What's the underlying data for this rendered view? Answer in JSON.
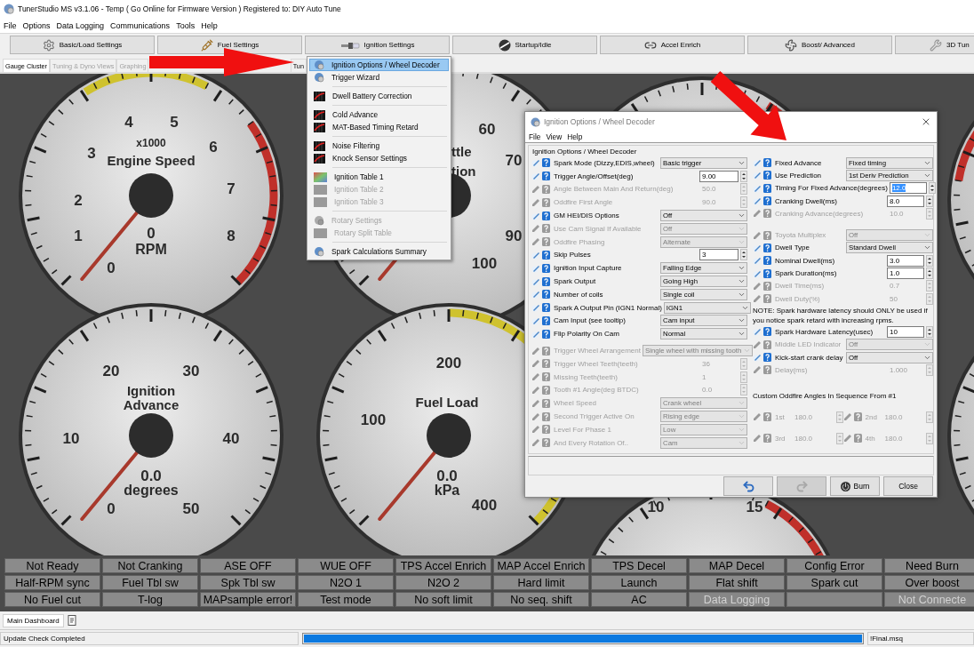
{
  "window": {
    "title": "TunerStudio MS v3.1.06 - Temp ( Go Online for Firmware Version ) Registered to: DIY Auto Tune"
  },
  "menu": [
    "File",
    "Options",
    "Data Logging",
    "Communications",
    "Tools",
    "Help"
  ],
  "toolbar": [
    {
      "label": "Basic/Load Settings",
      "kind": "gear"
    },
    {
      "label": "Fuel Settings",
      "kind": "injector"
    },
    {
      "label": "Ignition Settings",
      "kind": "plug"
    },
    {
      "label": "Startup/Idle",
      "kind": "knob"
    },
    {
      "label": "Accel Enrich",
      "kind": "link"
    },
    {
      "label": "Boost/ Advanced",
      "kind": "fan"
    },
    {
      "label": "3D Tun",
      "kind": "wrench"
    }
  ],
  "tabs": [
    {
      "label": "Gauge Cluster",
      "selected": true,
      "disabled": false
    },
    {
      "label": "Tuning & Dyno Views",
      "selected": false,
      "disabled": true
    },
    {
      "label": "Graphing",
      "selected": false,
      "disabled": true
    },
    {
      "label": "Tun",
      "selected": false,
      "disabled": false
    }
  ],
  "gauges": [
    {
      "title": [
        "Engine Speed"
      ],
      "scale": "x1000",
      "value": "0",
      "unit": "RPM",
      "ticks": [
        "0",
        "1",
        "2",
        "3",
        "4",
        "5",
        "6",
        "7",
        "8"
      ]
    },
    {
      "title": [
        "ttle",
        "tion"
      ],
      "ticks": [
        "60",
        "70",
        "90",
        "100"
      ]
    },
    {
      "title": [
        "Ignition",
        "Advance"
      ],
      "value": "0.0",
      "unit": "degrees",
      "ticks": [
        "0",
        "10",
        "20",
        "30",
        "40",
        "50"
      ]
    },
    {
      "title": [
        "Fuel Load"
      ],
      "value": "0.0",
      "unit": "kPa",
      "ticks": [
        "100",
        "200",
        "400"
      ]
    },
    {
      "ticks": [
        "10",
        "15"
      ]
    }
  ],
  "indicators": [
    {
      "label": "Not Ready",
      "disabled": false
    },
    {
      "label": "Not Cranking",
      "disabled": false
    },
    {
      "label": "ASE OFF",
      "disabled": false
    },
    {
      "label": "WUE OFF",
      "disabled": false
    },
    {
      "label": "TPS Accel Enrich",
      "disabled": false
    },
    {
      "label": "MAP Accel Enrich",
      "disabled": false
    },
    {
      "label": "TPS Decel",
      "disabled": false
    },
    {
      "label": "MAP Decel",
      "disabled": false
    },
    {
      "label": "Config Error",
      "disabled": false
    },
    {
      "label": "Need Burn",
      "disabled": false
    },
    {
      "label": "Half-RPM sync",
      "disabled": false
    },
    {
      "label": "Fuel Tbl sw",
      "disabled": false
    },
    {
      "label": "Spk Tbl sw",
      "disabled": false
    },
    {
      "label": "N2O 1",
      "disabled": false
    },
    {
      "label": "N2O 2",
      "disabled": false
    },
    {
      "label": "Hard limit",
      "disabled": false
    },
    {
      "label": "Launch",
      "disabled": false
    },
    {
      "label": "Flat shift",
      "disabled": false
    },
    {
      "label": "Spark cut",
      "disabled": false
    },
    {
      "label": "Over boost",
      "disabled": false
    },
    {
      "label": "No Fuel cut",
      "disabled": false
    },
    {
      "label": "T-log",
      "disabled": false
    },
    {
      "label": "MAPsample error!",
      "disabled": false
    },
    {
      "label": "Test mode",
      "disabled": false
    },
    {
      "label": "No soft limit",
      "disabled": false
    },
    {
      "label": "No seq. shift",
      "disabled": false
    },
    {
      "label": "AC",
      "disabled": false
    },
    {
      "label": "Data Logging",
      "disabled": true
    },
    {
      "disabled": true
    },
    {
      "label": "Not Connecte",
      "disabled": true
    }
  ],
  "dashboard_tabs": [
    {
      "label": "Main Dashboard",
      "selected": true
    }
  ],
  "status_bar": {
    "message": "Update Check Completed",
    "progress": {
      "level": 1
    },
    "file": "!Final.msq"
  },
  "dropdown": {
    "groups": [
      [
        {
          "label": "Ignition Options / Wheel Decoder",
          "kind": "wizard",
          "disabled": false,
          "selected": true
        },
        {
          "label": "Trigger Wizard",
          "kind": "wizard",
          "disabled": false,
          "selected": false
        }
      ],
      [
        {
          "label": "Dwell Battery Correction",
          "kind": "curve",
          "disabled": false,
          "selected": false
        }
      ],
      [
        {
          "label": "Cold Advance",
          "kind": "curve",
          "disabled": false,
          "selected": false
        },
        {
          "label": "MAT-Based Timing Retard",
          "kind": "curve",
          "disabled": false,
          "selected": false
        }
      ],
      [
        {
          "label": "Noise Filtering",
          "kind": "curve",
          "disabled": false,
          "selected": false
        },
        {
          "label": "Knock Sensor Settings",
          "kind": "curve",
          "disabled": false,
          "selected": false
        }
      ],
      [
        {
          "label": "Ignition Table 1",
          "kind": "table",
          "disabled": false,
          "selected": false
        },
        {
          "label": "Ignition Table 2",
          "kind": "table",
          "disabled": true,
          "selected": false
        },
        {
          "label": "Ignition Table 3",
          "kind": "table",
          "disabled": true,
          "selected": false
        }
      ],
      [
        {
          "label": "Rotary Settings",
          "kind": "wizard",
          "disabled": true,
          "selected": false
        },
        {
          "label": "Rotary Split Table",
          "kind": "table",
          "disabled": true,
          "selected": false
        }
      ],
      [
        {
          "label": "Spark Calculations Summary",
          "kind": "wizard",
          "disabled": false,
          "selected": false
        }
      ]
    ]
  },
  "dialog": {
    "title": "Ignition Options / Wheel Decoder",
    "menu": [
      "File",
      "View",
      "Help"
    ],
    "group": "Ignition Options / Wheel Decoder",
    "left": [
      {
        "kind": "select",
        "label": "Spark Mode (Dizzy,EDIS,wheel)",
        "value": "Basic trigger",
        "disabled": false
      },
      {
        "kind": "number",
        "label": "Trigger Angle/Offset(deg)",
        "value": "9.00",
        "disabled": false,
        "text_selected": false
      },
      {
        "kind": "number",
        "label": "Angle Between Main And Return(deg)",
        "value": "50.0",
        "disabled": true,
        "text_selected": false
      },
      {
        "kind": "number",
        "label": "Oddfire First Angle",
        "value": "90.0",
        "disabled": true,
        "text_selected": false
      },
      {
        "kind": "select",
        "label": "GM HEI/DIS Options",
        "value": "Off",
        "disabled": false
      },
      {
        "kind": "select",
        "label": "Use Cam Signal If Available",
        "value": "Off",
        "disabled": true
      },
      {
        "kind": "select",
        "label": "Oddfire Phasing",
        "value": "Alternate",
        "disabled": true
      },
      {
        "kind": "number",
        "label": "Skip Pulses",
        "value": "3",
        "disabled": false,
        "text_selected": false
      },
      {
        "kind": "select",
        "label": "Ignition Input Capture",
        "value": "Falling Edge",
        "disabled": false
      },
      {
        "kind": "select",
        "label": "Spark Output",
        "value": "Going High",
        "disabled": false
      },
      {
        "kind": "select",
        "label": "Number of coils",
        "value": "Single coil",
        "disabled": false
      },
      {
        "kind": "select",
        "label": "Spark A Output Pin (IGN1 Normal)",
        "value": "IGN1",
        "disabled": false
      },
      {
        "kind": "select",
        "label": "Cam Input (see tooltip)",
        "value": "Cam input",
        "disabled": false
      },
      {
        "kind": "select",
        "label": "Flip Polarity On Cam",
        "value": "Normal",
        "disabled": false
      },
      {
        "kind": "spacer"
      },
      {
        "kind": "wide_select",
        "label": "Trigger Wheel Arrangement",
        "value": "Single wheel with missing tooth",
        "disabled": true
      },
      {
        "kind": "number",
        "label": "Trigger Wheel Teeth(teeth)",
        "value": "36",
        "disabled": true,
        "text_selected": false
      },
      {
        "kind": "number",
        "label": "Missing Teeth(teeth)",
        "value": "1",
        "disabled": true,
        "text_selected": false
      },
      {
        "kind": "number",
        "label": "Tooth #1 Angle(deg BTDC)",
        "value": "0.0",
        "disabled": true,
        "text_selected": false
      },
      {
        "kind": "select",
        "label": "Wheel Speed",
        "value": "Crank wheel",
        "disabled": true
      },
      {
        "kind": "select",
        "label": "Second Trigger Active On",
        "value": "Rising edge",
        "disabled": true
      },
      {
        "kind": "select",
        "label": "Level For Phase 1",
        "value": "Low",
        "disabled": true
      },
      {
        "kind": "select",
        "label": "And Every Rotation Of..",
        "value": "Cam",
        "disabled": true
      }
    ],
    "right": [
      {
        "kind": "select",
        "label": "Fixed Advance",
        "value": "Fixed timing",
        "disabled": false
      },
      {
        "kind": "select",
        "label": "Use Prediction",
        "value": "1st Deriv Prediction",
        "disabled": false
      },
      {
        "kind": "number",
        "label": "Timing For Fixed Advance(degrees)",
        "value": "12.0",
        "disabled": false,
        "text_selected": true
      },
      {
        "kind": "number",
        "label": "Cranking Dwell(ms)",
        "value": "8.0",
        "disabled": false,
        "text_selected": false
      },
      {
        "kind": "number",
        "label": "Cranking Advance(degrees)",
        "value": "10.0",
        "disabled": true,
        "text_selected": false
      },
      {
        "kind": "spacer"
      },
      {
        "kind": "select",
        "label": "Toyota Multiplex",
        "value": "Off",
        "disabled": true
      },
      {
        "kind": "select",
        "label": "Dwell Type",
        "value": "Standard Dwell",
        "disabled": false
      },
      {
        "kind": "number",
        "label": "Nominal Dwell(ms)",
        "value": "3.0",
        "disabled": false,
        "text_selected": false
      },
      {
        "kind": "number",
        "label": "Spark Duration(ms)",
        "value": "1.0",
        "disabled": false,
        "text_selected": false
      },
      {
        "kind": "number",
        "label": "Dwell Time(ms)",
        "value": "0.7",
        "disabled": true,
        "text_selected": false
      },
      {
        "kind": "number",
        "label": "Dwell Duty(%)",
        "value": "50",
        "disabled": true,
        "text_selected": false
      },
      {
        "kind": "note",
        "label": "NOTE: Spark hardware latency should ONLY be used if you notice spark retard with increasing rpms."
      },
      {
        "kind": "number",
        "label": "Spark Hardware Latency(usec)",
        "value": "10",
        "disabled": false,
        "text_selected": false
      },
      {
        "kind": "select",
        "label": "Middle LED Indicator",
        "value": "Off",
        "disabled": true
      },
      {
        "kind": "select",
        "label": "Kick-start crank delay",
        "value": "Off",
        "disabled": false
      },
      {
        "kind": "number",
        "label": "Delay(ms)",
        "value": "1.000",
        "disabled": true,
        "text_selected": false
      },
      {
        "kind": "spacer"
      },
      {
        "kind": "heading",
        "label": "Custom Oddfire Angles In Sequence From #1"
      },
      {
        "kind": "pair",
        "disabled": true,
        "items": [
          {
            "label": "1st",
            "value": "180.0"
          },
          {
            "label": "2nd",
            "value": "180.0"
          }
        ]
      },
      {
        "kind": "pair",
        "disabled": true,
        "items": [
          {
            "label": "3rd",
            "value": "180.0"
          },
          {
            "label": "4th",
            "value": "180.0"
          }
        ]
      }
    ],
    "buttons": [
      {
        "kind": "undo",
        "disabled": false
      },
      {
        "kind": "redo",
        "disabled": true
      },
      {
        "kind": "burn",
        "label": "Burn",
        "disabled": false
      },
      {
        "kind": "close",
        "label": "Close",
        "disabled": false
      }
    ]
  }
}
